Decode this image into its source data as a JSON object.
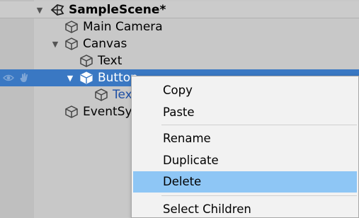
{
  "hierarchy": {
    "scene": "SampleScene*",
    "items": [
      {
        "label": "Main Camera"
      },
      {
        "label": "Canvas"
      },
      {
        "label": "Text"
      },
      {
        "label": "Button"
      },
      {
        "label": "Text"
      },
      {
        "label": "EventSystem"
      }
    ],
    "selected_color": "#3a78c3"
  },
  "context_menu": {
    "items": [
      {
        "label": "Copy"
      },
      {
        "label": "Paste"
      },
      {
        "label": "Rename"
      },
      {
        "label": "Duplicate"
      },
      {
        "label": "Delete",
        "highlighted": true
      },
      {
        "label": "Select Children"
      }
    ],
    "highlight_color": "#8ec6f5"
  }
}
